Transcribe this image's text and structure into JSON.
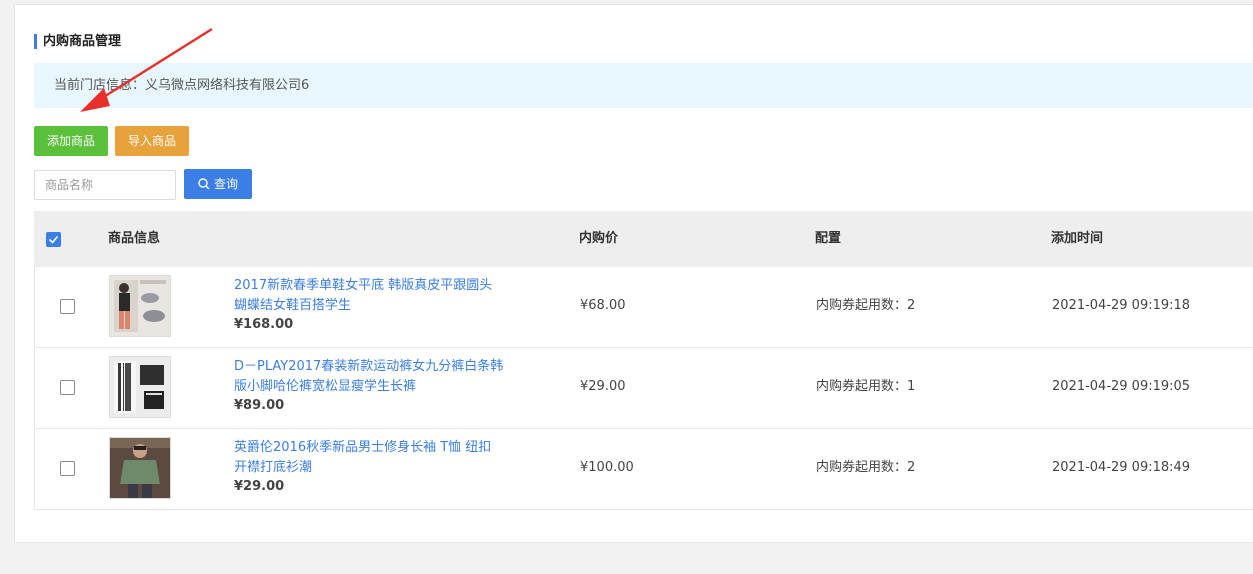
{
  "page": {
    "title": "内购商品管理",
    "store_label": "当前门店信息：",
    "store_name": "义乌微点网络科技有限公司6"
  },
  "toolbar": {
    "add_label": "添加商品",
    "import_label": "导入商品",
    "search_placeholder": "商品名称",
    "search_label": "查询"
  },
  "table": {
    "headers": {
      "info": "商品信息",
      "price": "内购价",
      "config": "配置",
      "time": "添加时间"
    },
    "rows": [
      {
        "name": "2017新款春季单鞋女平底 韩版真皮平跟圆头蝴蝶结女鞋百搭学生",
        "price": "¥168.00",
        "inner_price": "¥68.00",
        "config": "内购券起用数：2",
        "time": "2021-04-29 09:19:18"
      },
      {
        "name": "D－PLAY2017春装新款运动裤女九分裤白条韩版小脚哈伦裤宽松显瘦学生长裤",
        "price": "¥89.00",
        "inner_price": "¥29.00",
        "config": "内购券起用数：1",
        "time": "2021-04-29 09:19:05"
      },
      {
        "name": "英爵伦2016秋季新品男士修身长袖 T恤 纽扣开襟打底衫潮",
        "price": "¥29.00",
        "inner_price": "¥100.00",
        "config": "内购券起用数：2",
        "time": "2021-04-29 09:18:49"
      }
    ]
  },
  "colors": {
    "accent": "#3a7ee6",
    "add_button": "#5bc03a",
    "import_button": "#e8a23b",
    "annotation_arrow": "#e8302a"
  }
}
